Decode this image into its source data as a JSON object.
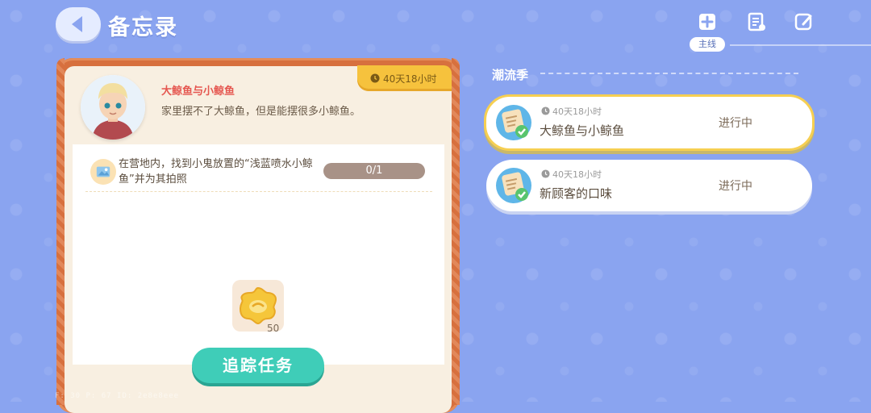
{
  "header": {
    "title": "备忘录",
    "tabs": [
      {
        "icon": "main-quest-icon",
        "label": "主线"
      },
      {
        "icon": "checklist-icon"
      },
      {
        "icon": "edit-note-icon"
      }
    ]
  },
  "detail": {
    "timer": "40天18小时",
    "task_name": "大鲸鱼与小鲸鱼",
    "task_desc": "家里摆不了大鲸鱼，但是能摆很多小鲸鱼。",
    "objective": "在营地内，找到小鬼放置的“浅蓝喷水小鲸鱼”并为其拍照",
    "progress": "0/1",
    "reward_count": "50",
    "track_button": "追踪任务"
  },
  "season": {
    "label": "潮流季",
    "quests": [
      {
        "timer": "40天18小时",
        "name": "大鲸鱼与小鲸鱼",
        "status": "进行中",
        "active": true
      },
      {
        "timer": "40天18小时",
        "name": "新顾客的口味",
        "status": "进行中",
        "active": false
      }
    ]
  },
  "debug": "F: 30  P: 67  ID: 2e8e8eee",
  "colors": {
    "background": "#8aa4f0",
    "panel_border": "#d7703e",
    "timer_tab": "#f6c23d",
    "track_button": "#3fcdb8",
    "active_border": "#f6cf52"
  }
}
